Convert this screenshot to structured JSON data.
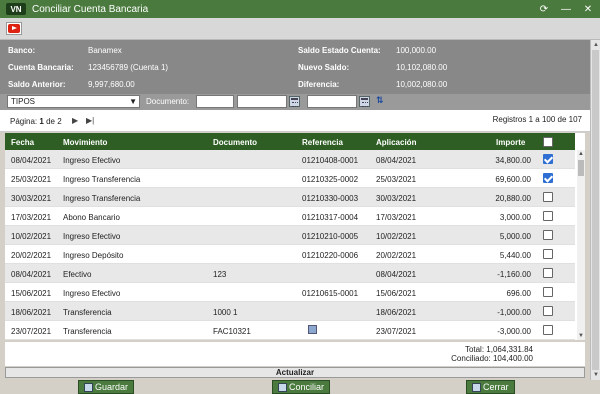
{
  "window": {
    "title": "Conciliar Cuenta Bancaria",
    "logo": "VN"
  },
  "info": {
    "banco_label": "Banco:",
    "banco": "Banamex",
    "cuenta_label": "Cuenta Bancaria:",
    "cuenta": "123456789 (Cuenta 1)",
    "saldo_anterior_label": "Saldo Anterior:",
    "saldo_anterior": "9,997,680.00",
    "saldo_estado_label": "Saldo Estado Cuenta:",
    "saldo_estado": "100,000.00",
    "nuevo_saldo_label": "Nuevo Saldo:",
    "nuevo_saldo": "10,102,080.00",
    "diferencia_label": "Diferencia:",
    "diferencia": "10,002,080.00"
  },
  "filters": {
    "tipo": "TIPOS",
    "documento_label": "Documento:"
  },
  "pager": {
    "pagina_label": "Página:",
    "page": "1",
    "of_label": "de",
    "total_pages": "2",
    "registros": "Registros 1 a 100 de 107"
  },
  "columns": {
    "fecha": "Fecha",
    "movimiento": "Movimiento",
    "documento": "Documento",
    "referencia": "Referencia",
    "aplicacion": "Aplicación",
    "importe": "Importe"
  },
  "rows": [
    {
      "fecha": "08/04/2021",
      "movimiento": "Ingreso Efectivo",
      "documento": "",
      "referencia": "01210408-0001",
      "aplicacion": "08/04/2021",
      "importe": "34,800.00",
      "checked": true
    },
    {
      "fecha": "25/03/2021",
      "movimiento": "Ingreso Transferencia",
      "documento": "",
      "referencia": "01210325-0002",
      "aplicacion": "25/03/2021",
      "importe": "69,600.00",
      "checked": true
    },
    {
      "fecha": "30/03/2021",
      "movimiento": "Ingreso Transferencia",
      "documento": "",
      "referencia": "01210330-0003",
      "aplicacion": "30/03/2021",
      "importe": "20,880.00",
      "checked": false
    },
    {
      "fecha": "17/03/2021",
      "movimiento": "Abono Bancario",
      "documento": "",
      "referencia": "01210317-0004",
      "aplicacion": "17/03/2021",
      "importe": "3,000.00",
      "checked": false
    },
    {
      "fecha": "10/02/2021",
      "movimiento": "Ingreso Efectivo",
      "documento": "",
      "referencia": "01210210-0005",
      "aplicacion": "10/02/2021",
      "importe": "5,000.00",
      "checked": false
    },
    {
      "fecha": "20/02/2021",
      "movimiento": "Ingreso Depósito",
      "documento": "",
      "referencia": "01210220-0006",
      "aplicacion": "20/02/2021",
      "importe": "5,440.00",
      "checked": false
    },
    {
      "fecha": "08/04/2021",
      "movimiento": "Efectivo",
      "documento": "123",
      "referencia": "",
      "aplicacion": "08/04/2021",
      "importe": "-1,160.00",
      "checked": false
    },
    {
      "fecha": "15/06/2021",
      "movimiento": "Ingreso Efectivo",
      "documento": "",
      "referencia": "01210615-0001",
      "aplicacion": "15/06/2021",
      "importe": "696.00",
      "checked": false
    },
    {
      "fecha": "18/06/2021",
      "movimiento": "Transferencia",
      "documento": "1000 1",
      "referencia": "",
      "aplicacion": "18/06/2021",
      "importe": "-1,000.00",
      "checked": false
    },
    {
      "fecha": "23/07/2021",
      "movimiento": "Transferencia",
      "documento": "FAC10321",
      "referencia": "",
      "aplicacion": "23/07/2021",
      "importe": "-3,000.00",
      "checked": false
    }
  ],
  "totals": {
    "total": "Total: 1,064,331.84",
    "conciliado": "Conciliado: 104,400.00"
  },
  "actualizar_label": "Actualizar",
  "buttons": {
    "guardar": "Guardar",
    "conciliar": "Conciliar",
    "cerrar": "Cerrar"
  }
}
